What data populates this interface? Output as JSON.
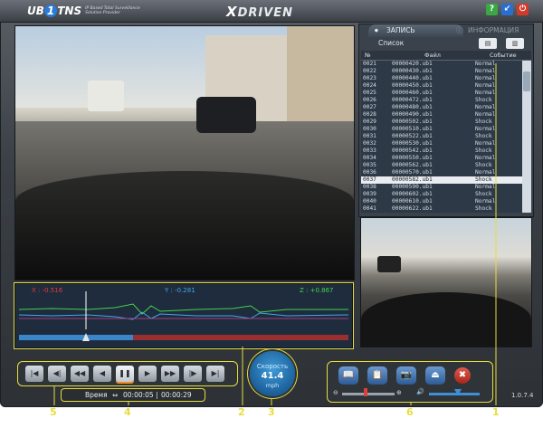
{
  "title_bar": {
    "logo_main": "UB",
    "logo_one": "1",
    "logo_sub": "TNS",
    "tagline": "IP Based Total Surveillance Solution Provider",
    "brand": "DRIVEN",
    "brand_x": "X",
    "buttons": [
      {
        "symbol": "?",
        "color": "#39a845"
      },
      {
        "symbol": "↙",
        "color": "#2a6fcf"
      },
      {
        "symbol": "⏻",
        "color": "#d43a2a"
      }
    ]
  },
  "graph": {
    "x_label": "X : -0.516",
    "y_label": "Y : -0.281",
    "z_label": "Z : +0.867",
    "colors": {
      "x": "#e33b3b",
      "y": "#3fa6e8",
      "z": "#42d44b"
    }
  },
  "tabs": {
    "active": "ЗАПИСЬ",
    "inactive": "ИНФОРМАЦИЯ"
  },
  "list": {
    "label": "Список",
    "columns": [
      "№",
      "Файл",
      "Событие"
    ],
    "rows": [
      {
        "no": "0021",
        "file": "00000420.ub1",
        "event": "Normal"
      },
      {
        "no": "0022",
        "file": "00000430.ub1",
        "event": "Normal"
      },
      {
        "no": "0023",
        "file": "00000440.ub1",
        "event": "Normal"
      },
      {
        "no": "0024",
        "file": "00000450.ub1",
        "event": "Normal"
      },
      {
        "no": "0025",
        "file": "00000460.ub1",
        "event": "Normal"
      },
      {
        "no": "0026",
        "file": "00000472.ub1",
        "event": "Shock"
      },
      {
        "no": "0027",
        "file": "00000480.ub1",
        "event": "Normal"
      },
      {
        "no": "0028",
        "file": "00000490.ub1",
        "event": "Normal"
      },
      {
        "no": "0029",
        "file": "00000502.ub1",
        "event": "Shock"
      },
      {
        "no": "0030",
        "file": "00000510.ub1",
        "event": "Normal"
      },
      {
        "no": "0031",
        "file": "00000522.ub1",
        "event": "Shock"
      },
      {
        "no": "0032",
        "file": "00000530.ub1",
        "event": "Normal"
      },
      {
        "no": "0033",
        "file": "00000542.ub1",
        "event": "Shock"
      },
      {
        "no": "0034",
        "file": "00000550.ub1",
        "event": "Normal"
      },
      {
        "no": "0035",
        "file": "00000562.ub1",
        "event": "Shock"
      },
      {
        "no": "0036",
        "file": "00000570.ub1",
        "event": "Normal"
      },
      {
        "no": "0037",
        "file": "00000582.ub1",
        "event": "Shock"
      },
      {
        "no": "0038",
        "file": "00000590.ub1",
        "event": "Normal"
      },
      {
        "no": "0039",
        "file": "00000602.ub1",
        "event": "Shock"
      },
      {
        "no": "0040",
        "file": "00000610.ub1",
        "event": "Normal"
      },
      {
        "no": "0041",
        "file": "00000622.ub1",
        "event": "Shock"
      }
    ],
    "selected_index": 16
  },
  "playback": {
    "buttons": [
      "|◀",
      "◀|",
      "◀◀",
      "◀",
      "❚❚",
      "▶",
      "▶▶",
      "|▶",
      "▶|"
    ],
    "active_index": 4
  },
  "time": {
    "label": "Время",
    "current": "00:00:05",
    "total": "00:00:29"
  },
  "speed": {
    "label": "Скорость",
    "value": "41.4",
    "unit": "mph"
  },
  "tools": {
    "buttons": [
      "📖",
      "📋",
      "📷",
      "⏏",
      "✖"
    ],
    "zoom_minus": "⊖",
    "zoom_plus": "⊕",
    "volume_icon": "🔊"
  },
  "version": "1.0.7.4",
  "callouts": [
    "5",
    "4",
    "2",
    "3",
    "6",
    "1"
  ]
}
